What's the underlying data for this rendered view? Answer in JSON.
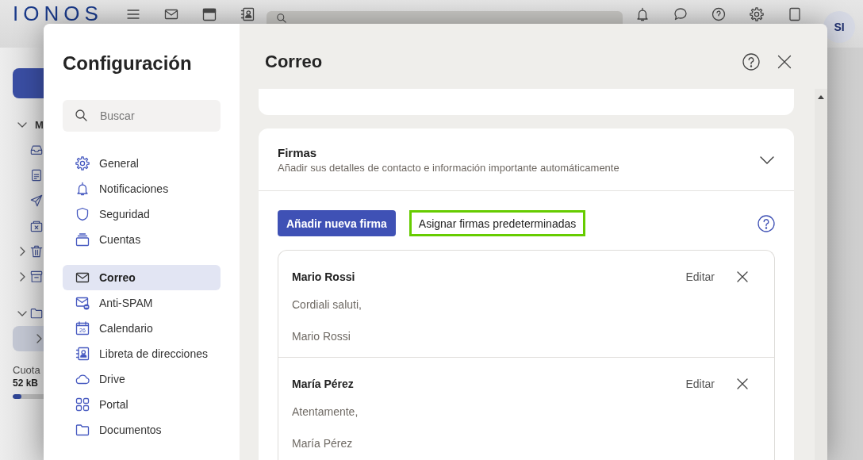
{
  "app": {
    "logo": "IONOS",
    "avatar": "SI",
    "folder_groups": [
      {
        "label": "M",
        "expanded": true,
        "items": [
          {
            "selected": false
          },
          {
            "selected": false
          },
          {
            "selected": false
          },
          {
            "selected": false
          },
          {
            "selected": false,
            "expanded": false
          },
          {
            "selected": false,
            "expanded": false
          }
        ]
      },
      {
        "expanded": true,
        "items": [
          {
            "selected": true,
            "expanded": false
          }
        ]
      }
    ],
    "quota": {
      "label": "Cuota",
      "value": "52 kB",
      "level": 0.28
    }
  },
  "settings": {
    "title": "Configuración",
    "search": {
      "placeholder": "Buscar"
    },
    "nav_groups": [
      [
        {
          "label": "General",
          "selected": false
        },
        {
          "label": "Notificaciones",
          "selected": false
        },
        {
          "label": "Seguridad",
          "selected": false
        },
        {
          "label": "Cuentas",
          "selected": false
        }
      ],
      [
        {
          "label": "Correo",
          "selected": true
        },
        {
          "label": "Anti-SPAM",
          "selected": false
        },
        {
          "label": "Calendario",
          "selected": false,
          "icon_label": "26"
        },
        {
          "label": "Libreta de direcciones",
          "selected": false
        },
        {
          "label": "Drive",
          "selected": false
        },
        {
          "label": "Portal",
          "selected": false
        },
        {
          "label": "Documentos",
          "selected": false
        }
      ]
    ]
  },
  "panel": {
    "title": "Correo",
    "signatures": {
      "title": "Firmas",
      "description": "Añadir sus detalles de contacto e información importante automáticamente",
      "expanded": true,
      "buttons": [
        {
          "label": "Añadir nueva firma",
          "kind": "primary",
          "highlighted": false
        },
        {
          "label": "Asignar firmas predeterminadas",
          "kind": "secondary",
          "highlighted": true
        }
      ],
      "items": [
        {
          "name": "Mario Rossi",
          "action": "Editar",
          "lines": [
            "Cordiali saluti,",
            "Mario Rossi"
          ]
        },
        {
          "name": "María Pérez",
          "action": "Editar",
          "lines": [
            "Atentamente,",
            "María Pérez"
          ]
        }
      ]
    }
  }
}
